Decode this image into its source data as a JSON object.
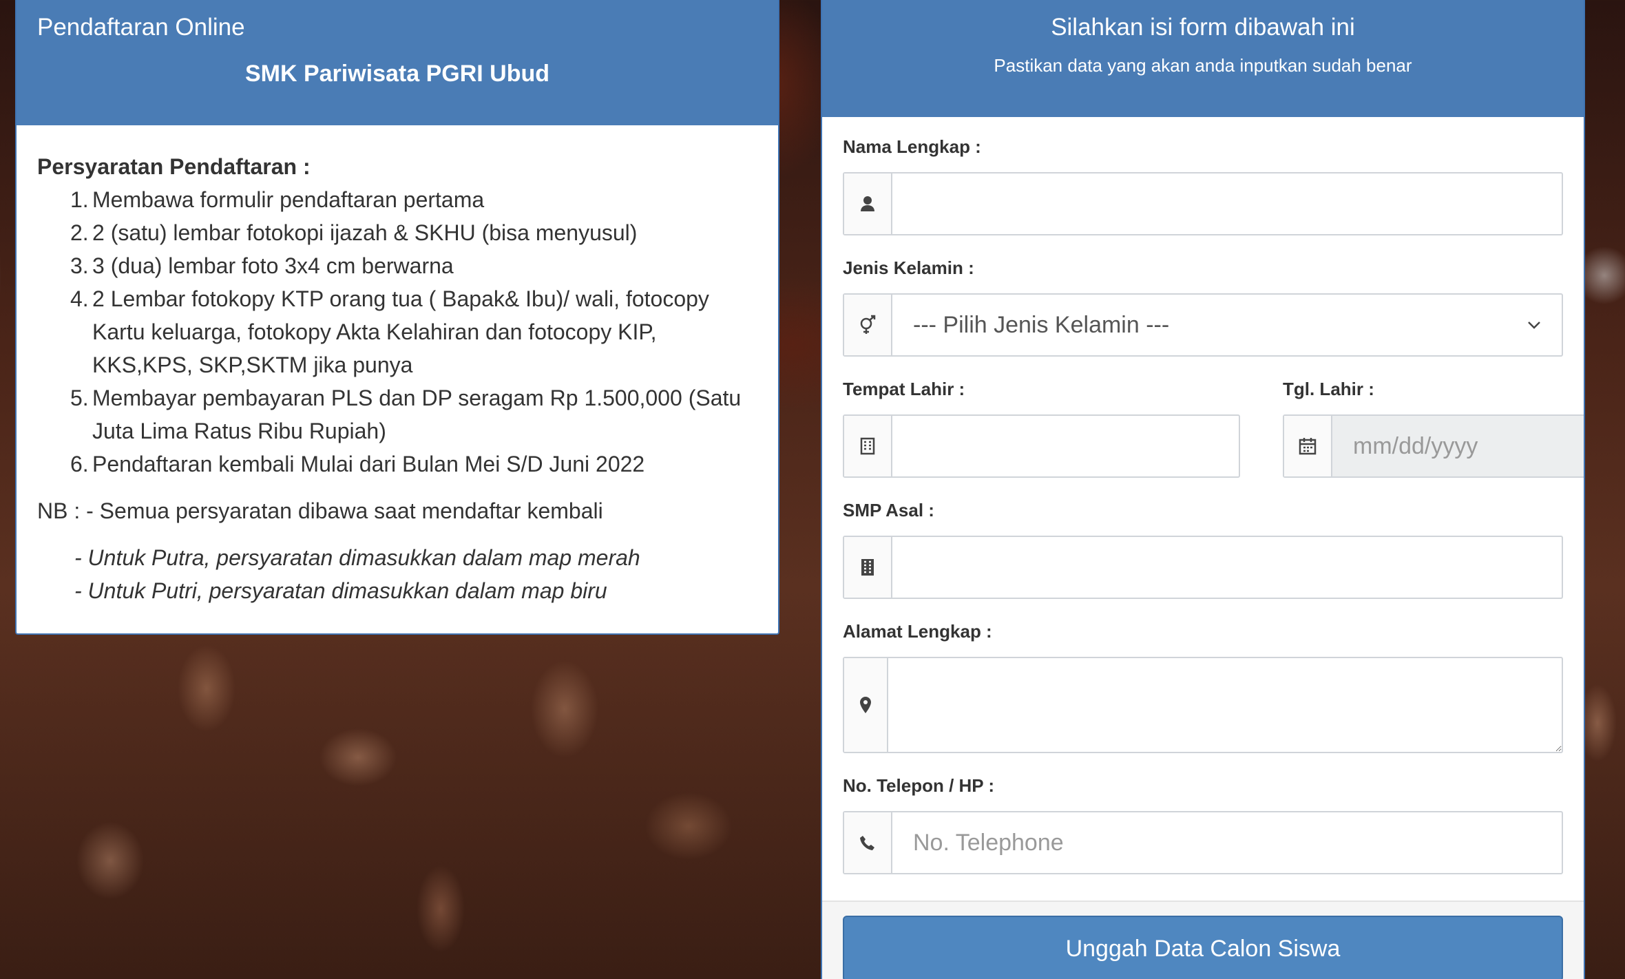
{
  "left_card": {
    "header_label": "Pendaftaran Online",
    "school_name": "SMK Pariwisata PGRI Ubud",
    "requirements_title": "Persyaratan Pendaftaran :",
    "requirements": [
      "Membawa formulir pendaftaran pertama",
      "2 (satu) lembar fotokopi ijazah & SKHU (bisa menyusul)",
      "3 (dua) lembar foto 3x4 cm berwarna",
      "2 Lembar fotokopy KTP orang tua ( Bapak& Ibu)/ wali, fotocopy Kartu keluarga, fotokopy Akta Kelahiran dan fotocopy KIP, KKS,KPS, SKP,SKTM jika punya",
      "Membayar pembayaran PLS  dan DP seragam Rp 1.500,000 (Satu Juta Lima Ratus Ribu Rupiah)",
      "Pendaftaran kembali Mulai dari Bulan Mei S/D Juni 2022"
    ],
    "nb": "NB : - Semua persyaratan dibawa saat  mendaftar kembali",
    "nb_lines": [
      "- Untuk Putra, persyaratan dimasukkan dalam map merah",
      "- Untuk Putri, persyaratan dimasukkan dalam map biru"
    ]
  },
  "form": {
    "title": "Silahkan isi form dibawah ini",
    "subtitle": "Pastikan data yang akan anda inputkan sudah benar",
    "nama": {
      "label": "Nama Lengkap :",
      "value": "",
      "icon": "user-icon"
    },
    "gender": {
      "label": "Jenis Kelamin :",
      "selected": "--- Pilih Jenis Kelamin ---",
      "icon": "gender-icon"
    },
    "tempat": {
      "label": "Tempat Lahir :",
      "value": "",
      "icon": "building-icon"
    },
    "tgl": {
      "label": "Tgl. Lahir :",
      "placeholder": "mm/dd/yyyy",
      "icon": "calendar-icon"
    },
    "smp": {
      "label": "SMP Asal :",
      "value": "",
      "icon": "school-building-icon"
    },
    "alamat": {
      "label": "Alamat Lengkap :",
      "value": "",
      "icon": "map-marker-icon"
    },
    "telepon": {
      "label": "No. Telepon / HP :",
      "placeholder": "No. Telephone",
      "icon": "phone-icon"
    },
    "submit_label": "Unggah Data Calon Siswa"
  },
  "colors": {
    "header_blue": "#4a7cb5",
    "border_blue": "#3f74b3",
    "button_blue": "#4f87c0"
  }
}
